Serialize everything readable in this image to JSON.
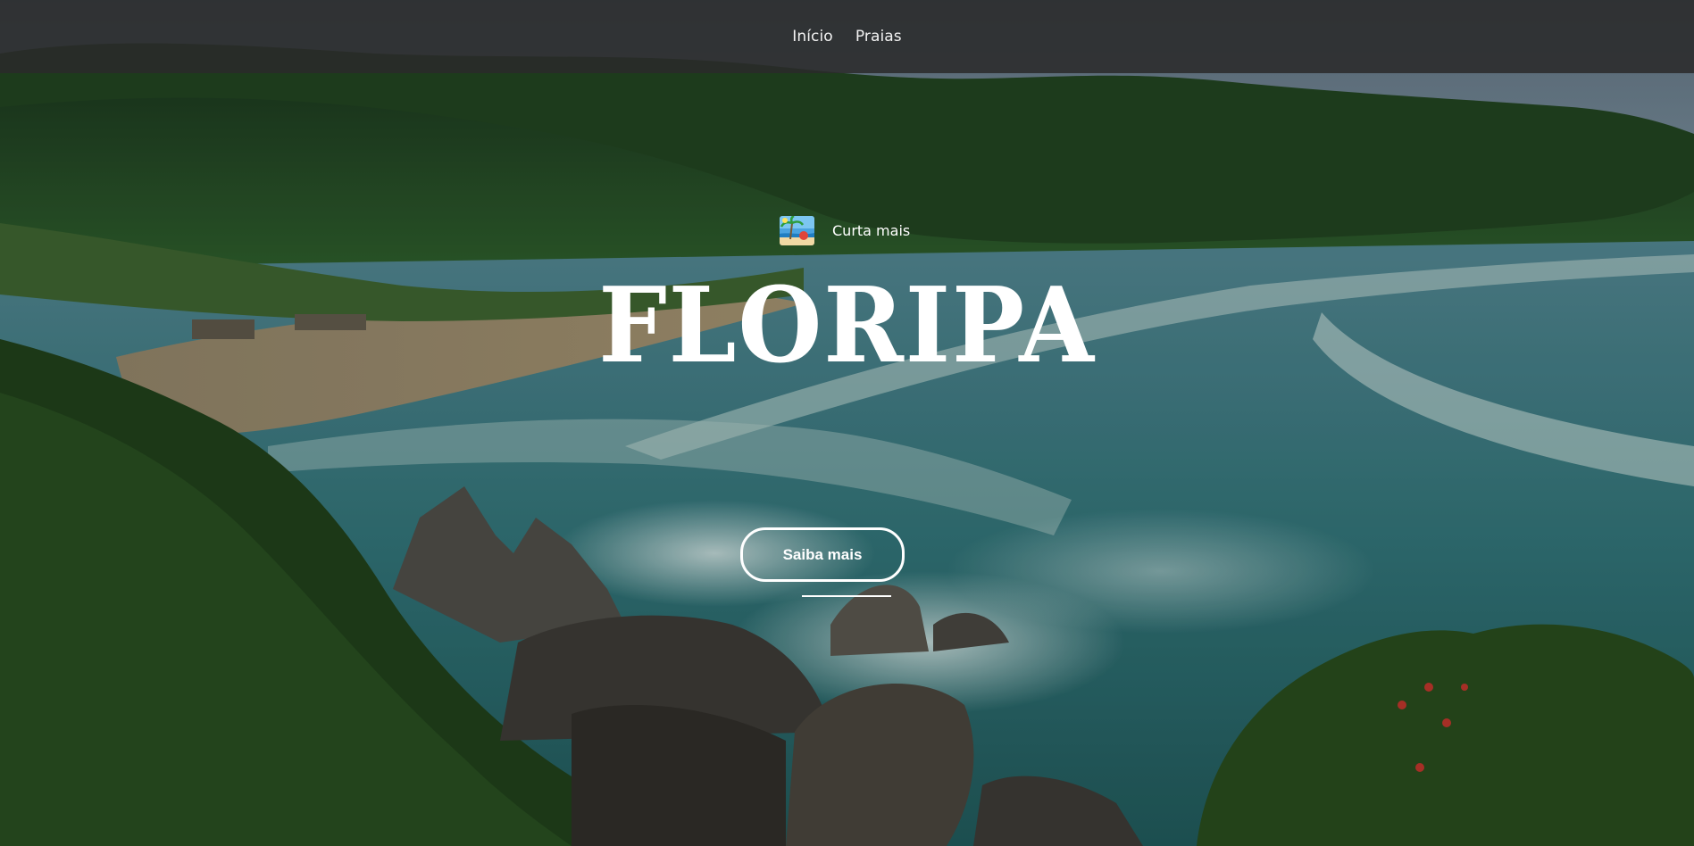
{
  "nav": {
    "items": [
      {
        "label": "Início"
      },
      {
        "label": "Praias"
      }
    ]
  },
  "hero": {
    "tagline": "Curta mais",
    "tagline_icon": "beach-icon",
    "title": "FLORIPA",
    "cta_label": "Saiba mais",
    "background": "beach-landscape-photo"
  },
  "colors": {
    "topbar": "#2a2a2a",
    "text": "#ffffff"
  }
}
